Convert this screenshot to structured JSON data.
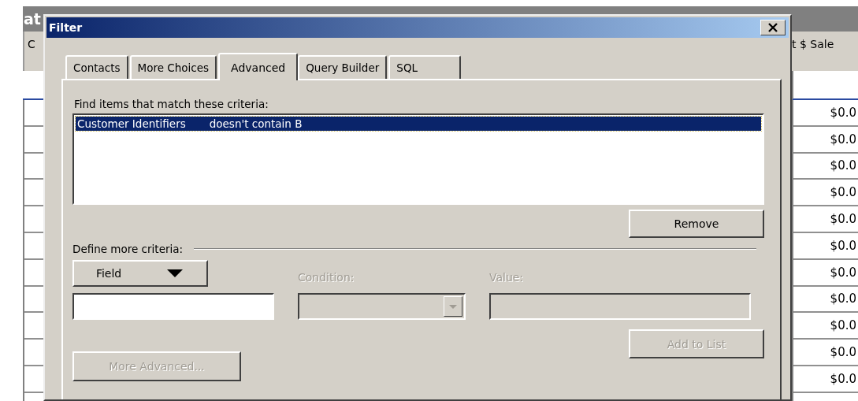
{
  "background_window": {
    "title": "at",
    "columns": [
      "C",
      "t $ Sale"
    ],
    "rows": [
      {
        "column_2": "$0.0"
      },
      {
        "column_2": "$0.0"
      },
      {
        "column_2": "$0.0"
      },
      {
        "column_2": "$0.0"
      },
      {
        "column_2": "$0.0"
      },
      {
        "column_2": "$0.0"
      },
      {
        "column_2": "$0.0"
      },
      {
        "column_2": "$0.0"
      },
      {
        "column_2": "$0.0"
      },
      {
        "column_2": "$0.0"
      },
      {
        "column_2": "$0.0"
      }
    ]
  },
  "dialog": {
    "title": "Filter",
    "tabs": [
      {
        "label": "Contacts",
        "selected": false
      },
      {
        "label": "More Choices",
        "selected": false
      },
      {
        "label": "Advanced",
        "selected": true
      },
      {
        "label": "Query Builder",
        "selected": false
      },
      {
        "label": "SQL",
        "selected": false
      }
    ],
    "criteria_label": "Find items that match these criteria:",
    "criteria": [
      {
        "field": "Customer Identifiers",
        "condition": "doesn't contain B",
        "selected": true
      }
    ],
    "remove_button": {
      "label": "Remove",
      "disabled": false
    },
    "define_label": "Define more criteria:",
    "field_button": {
      "label": "Field",
      "disabled": false
    },
    "field_input": {
      "disabled": false
    },
    "condition": {
      "label": "Condition:",
      "disabled": true
    },
    "value": {
      "label": "Value:",
      "disabled": true
    },
    "add_button": {
      "label": "Add to List",
      "disabled": true
    },
    "more_advanced_button": {
      "label": "More Advanced...",
      "disabled": true
    }
  }
}
